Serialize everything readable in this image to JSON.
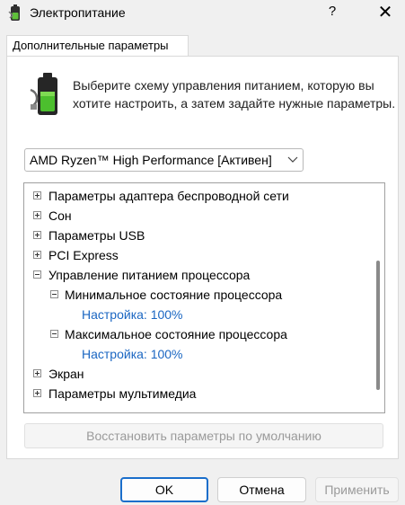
{
  "window": {
    "title": "Электропитание",
    "help": "?",
    "close": "✕"
  },
  "tab": {
    "label": "Дополнительные параметры"
  },
  "description": "Выберите схему управления питанием, которую вы хотите настроить, а затем задайте нужные параметры.",
  "scheme": {
    "selected": "AMD Ryzen™ High Performance [Активен]"
  },
  "tree": {
    "items": [
      {
        "label": "Параметры адаптера беспроводной сети",
        "state": "collapsed"
      },
      {
        "label": "Сон",
        "state": "collapsed"
      },
      {
        "label": "Параметры USB",
        "state": "collapsed"
      },
      {
        "label": "PCI Express",
        "state": "collapsed"
      },
      {
        "label": "Управление питанием процессора",
        "state": "expanded"
      },
      {
        "label": "Минимальное состояние процессора",
        "state": "expanded"
      },
      {
        "label": "Настройка: 100%",
        "state": "value"
      },
      {
        "label": "Максимальное состояние процессора",
        "state": "expanded"
      },
      {
        "label": "Настройка: 100%",
        "state": "value"
      },
      {
        "label": "Экран",
        "state": "collapsed"
      },
      {
        "label": "Параметры мультимедиа",
        "state": "collapsed"
      }
    ]
  },
  "restore_button": "Восстановить параметры по умолчанию",
  "buttons": {
    "ok": "OK",
    "cancel": "Отмена",
    "apply": "Применить"
  },
  "colors": {
    "accent": "#1a6ecb",
    "link": "#1a66c2",
    "disabled_text": "#9a9a9a"
  },
  "icons": {
    "app": "battery-plug-icon",
    "panel": "battery-plug-icon"
  }
}
